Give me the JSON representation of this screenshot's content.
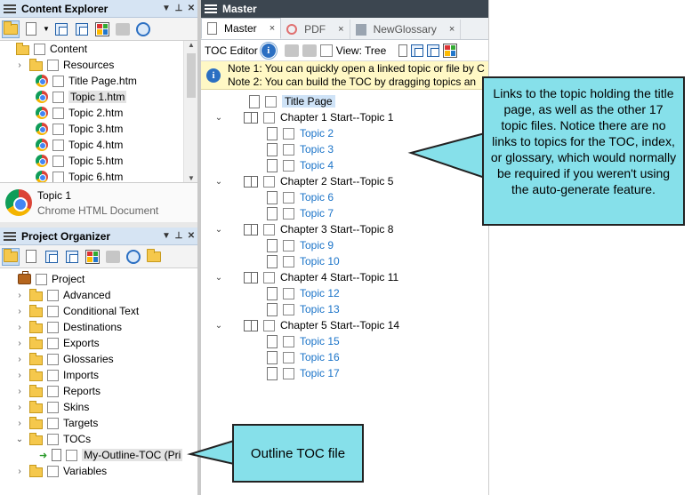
{
  "content_explorer": {
    "title": "Content Explorer",
    "tree": [
      {
        "label": "Content",
        "icon": "folder-open-icon",
        "expander": ""
      },
      {
        "label": "Resources",
        "icon": "folder-icon",
        "expander": "›"
      },
      {
        "label": "Title Page.htm",
        "icon": "chrome-icon",
        "expander": ""
      },
      {
        "label": "Topic 1.htm",
        "icon": "chrome-icon",
        "expander": "",
        "selected": true
      },
      {
        "label": "Topic 2.htm",
        "icon": "chrome-icon",
        "expander": ""
      },
      {
        "label": "Topic 3.htm",
        "icon": "chrome-icon",
        "expander": ""
      },
      {
        "label": "Topic 4.htm",
        "icon": "chrome-icon",
        "expander": ""
      },
      {
        "label": "Topic 5.htm",
        "icon": "chrome-icon",
        "expander": ""
      },
      {
        "label": "Topic 6.htm",
        "icon": "chrome-icon",
        "expander": ""
      }
    ],
    "file_info": {
      "name": "Topic 1",
      "type": "Chrome HTML Document"
    }
  },
  "project_organizer": {
    "title": "Project Organizer",
    "root": "Project",
    "items": [
      {
        "label": "Advanced",
        "expander": "›"
      },
      {
        "label": "Conditional Text",
        "expander": "›"
      },
      {
        "label": "Destinations",
        "expander": "›"
      },
      {
        "label": "Exports",
        "expander": "›"
      },
      {
        "label": "Glossaries",
        "expander": "›"
      },
      {
        "label": "Imports",
        "expander": "›"
      },
      {
        "label": "Reports",
        "expander": "›"
      },
      {
        "label": "Skins",
        "expander": "›"
      },
      {
        "label": "Targets",
        "expander": "›"
      },
      {
        "label": "TOCs",
        "expander": "⌄"
      }
    ],
    "toc_file": "My-Outline-TOC (Pri",
    "last_item": {
      "label": "Variables",
      "expander": "›"
    }
  },
  "editor": {
    "window_title": "Master",
    "tabs": [
      {
        "label": "Master",
        "close": "×"
      },
      {
        "label": "PDF",
        "close": "×"
      },
      {
        "label": "NewGlossary",
        "close": "×"
      }
    ],
    "toolbar": {
      "editor_label": "TOC Editor",
      "view_label": "View: Tree"
    },
    "notes": [
      "Note 1: You can quickly open a linked topic or file by C",
      "Note 2: You can build the TOC by dragging topics an"
    ],
    "toc": [
      {
        "kind": "title",
        "label": "Title Page"
      },
      {
        "kind": "book",
        "label": "Chapter 1 Start--Topic 1"
      },
      {
        "kind": "child",
        "label": "Topic 2"
      },
      {
        "kind": "child",
        "label": "Topic 3"
      },
      {
        "kind": "child",
        "label": "Topic 4"
      },
      {
        "kind": "book",
        "label": "Chapter 2 Start--Topic 5"
      },
      {
        "kind": "child",
        "label": "Topic 6"
      },
      {
        "kind": "child",
        "label": "Topic 7"
      },
      {
        "kind": "book",
        "label": "Chapter 3 Start--Topic 8"
      },
      {
        "kind": "child",
        "label": "Topic 9"
      },
      {
        "kind": "child",
        "label": "Topic 10"
      },
      {
        "kind": "book",
        "label": "Chapter 4 Start--Topic 11"
      },
      {
        "kind": "child",
        "label": "Topic 12"
      },
      {
        "kind": "child",
        "label": "Topic 13"
      },
      {
        "kind": "book",
        "label": "Chapter 5 Start--Topic 14"
      },
      {
        "kind": "child",
        "label": "Topic 15"
      },
      {
        "kind": "child",
        "label": "Topic 16"
      },
      {
        "kind": "child",
        "label": "Topic 17"
      }
    ]
  },
  "callouts": {
    "top": "Links to the topic holding the title page, as well as the other 17 topic files. Notice there are no links to topics for the TOC, index, or glossary, which would normally be required if you weren't using the auto-generate feature.",
    "bottom": "Outline TOC file",
    "fill_color": "#86e0ea"
  }
}
